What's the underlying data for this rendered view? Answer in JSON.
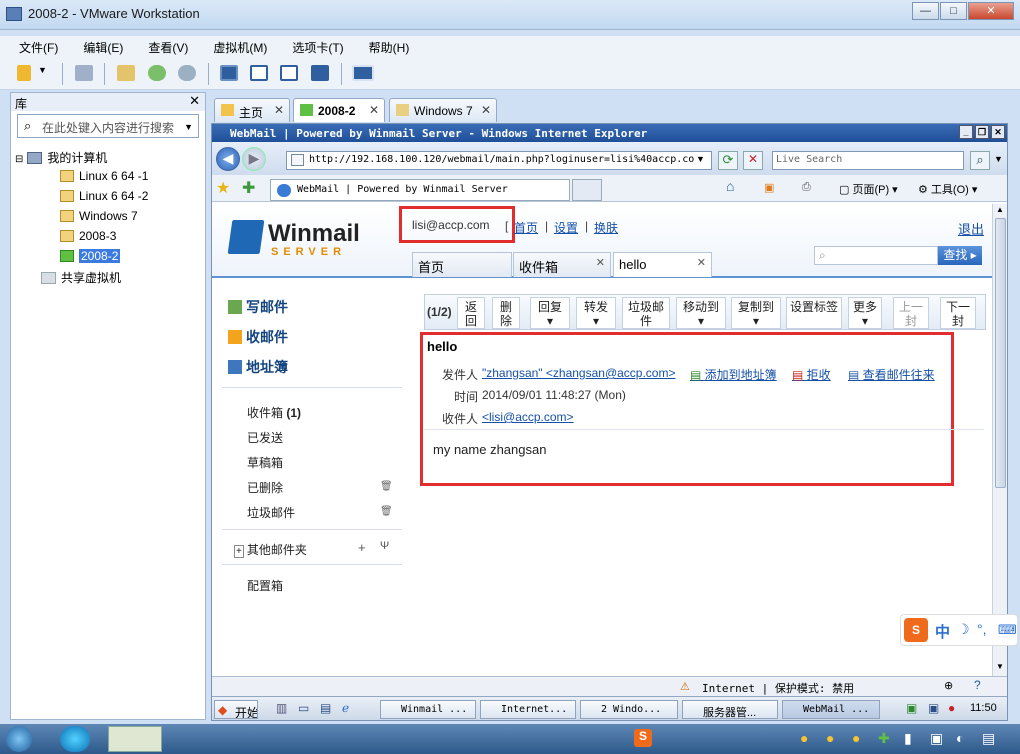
{
  "vmware": {
    "title": "2008-2 - VMware Workstation",
    "menu": [
      "文件(F)",
      "编辑(E)",
      "查看(V)",
      "虚拟机(M)",
      "选项卡(T)",
      "帮助(H)"
    ],
    "library": {
      "title": "库",
      "search_placeholder": "在此处键入内容进行搜索",
      "root": "我的计算机",
      "vms": [
        "Linux 6 64 -1",
        "Linux 6 64 -2",
        "Windows 7",
        "2008-3",
        "2008-2"
      ],
      "shared": "共享虚拟机"
    },
    "tabs": [
      "主页",
      "2008-2",
      "Windows 7"
    ]
  },
  "ie": {
    "title": "WebMail | Powered by Winmail Server - Windows Internet Explorer",
    "address": "http://192.168.100.120/webmail/main.php?loginuser=lisi%40accp.co",
    "live_search": "Live Search",
    "fav_tab": "WebMail | Powered by Winmail Server",
    "page_menu": "页面(P)",
    "tools_menu": "工具(O)",
    "status_zone": "Internet | 保护模式: 禁用"
  },
  "webmail": {
    "logo_main": "Winmail",
    "logo_sub": "SERVER",
    "user": "lisi@accp.com",
    "links": [
      "首页",
      "设置",
      "换肤"
    ],
    "logout": "退出",
    "search_button": "查找",
    "tabs": [
      "首页",
      "收件箱",
      "hello"
    ],
    "nav_big": [
      "写邮件",
      "收邮件",
      "地址簿"
    ],
    "folders": [
      {
        "name": "收件箱",
        "count": "(1)"
      },
      {
        "name": "已发送",
        "count": ""
      },
      {
        "name": "草稿箱",
        "count": ""
      },
      {
        "name": "已删除",
        "count": ""
      },
      {
        "name": "垃圾邮件",
        "count": ""
      }
    ],
    "other_folders": "其他邮件夹",
    "config_box": "配置箱",
    "toolbar": {
      "counter": "(1/2)",
      "buttons": [
        "返回",
        "删除",
        "回复",
        "转发",
        "垃圾邮件",
        "移动到",
        "复制到",
        "设置标签",
        "更多",
        "上一封",
        "下一封"
      ]
    },
    "message": {
      "subject": "hello",
      "from_label": "发件人",
      "from_value": "\"zhangsan\" <zhangsan@accp.com>",
      "add_contact": "添加到地址簿",
      "reject": "拒收",
      "view_thread": "查看邮件往来",
      "time_label": "时间",
      "time_value": "2014/09/01 11:48:27 (Mon)",
      "to_label": "收件人",
      "to_value": "<lisi@accp.com>",
      "body": "my name zhangsan"
    }
  },
  "guest_taskbar": {
    "start": "开始",
    "items": [
      "Winmail ...",
      "Internet...",
      "2 Windo...",
      "服务器管...",
      "WebMail ..."
    ],
    "clock": "11:50"
  }
}
